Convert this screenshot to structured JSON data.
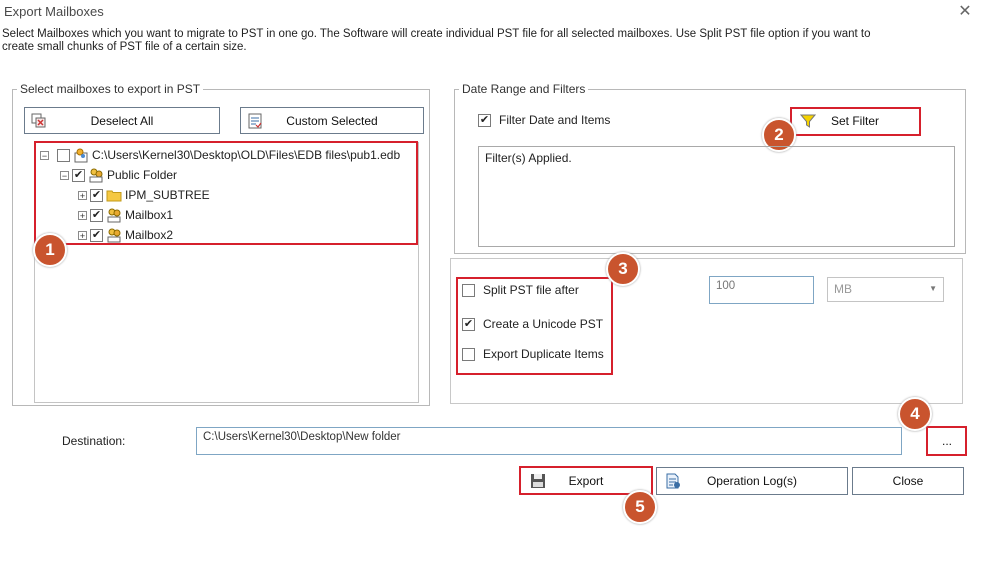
{
  "window": {
    "title": "Export Mailboxes",
    "close_glyph": "✕",
    "description": "Select Mailboxes which you want to migrate to PST in one go. The Software will create individual PST file for all selected mailboxes. Use Split PST file option if you want to create small chunks of PST file of a certain size."
  },
  "mailbox_group": {
    "legend": "Select mailboxes to export in PST",
    "deselect_all": "Deselect All",
    "custom_selected": "Custom Selected",
    "tree": [
      {
        "label": "C:\\Users\\Kernel30\\Desktop\\OLD\\Files\\EDB files\\pub1.edb",
        "checked": false,
        "icon": "database-icon"
      },
      {
        "label": "Public Folder",
        "checked": true,
        "icon": "public-folder-icon"
      },
      {
        "label": "IPM_SUBTREE",
        "checked": true,
        "icon": "folder-icon"
      },
      {
        "label": "Mailbox1",
        "checked": true,
        "icon": "mailbox-icon"
      },
      {
        "label": "Mailbox2",
        "checked": true,
        "icon": "mailbox-icon"
      }
    ]
  },
  "filter_group": {
    "legend": "Date Range and Filters",
    "filter_checkbox_label": "Filter Date and Items",
    "filter_checked": true,
    "set_filter": "Set Filter",
    "filters_applied_text": "Filter(s) Applied."
  },
  "options": {
    "split_label": "Split PST file after",
    "split_checked": false,
    "unicode_label": "Create a Unicode PST",
    "unicode_checked": true,
    "duplicate_label": "Export Duplicate Items",
    "duplicate_checked": false,
    "split_size_value": "100",
    "split_unit": "MB"
  },
  "destination": {
    "label": "Destination:",
    "path": "C:\\Users\\Kernel30\\Desktop\\New folder",
    "browse": "..."
  },
  "actions": {
    "export": "Export",
    "operation_log": "Operation Log(s)",
    "close": "Close"
  },
  "callouts": [
    "1",
    "2",
    "3",
    "4",
    "5"
  ],
  "colors": {
    "highlight_red": "#d6202c",
    "badge": "#c9542e",
    "input_border": "#7fa6c4"
  }
}
